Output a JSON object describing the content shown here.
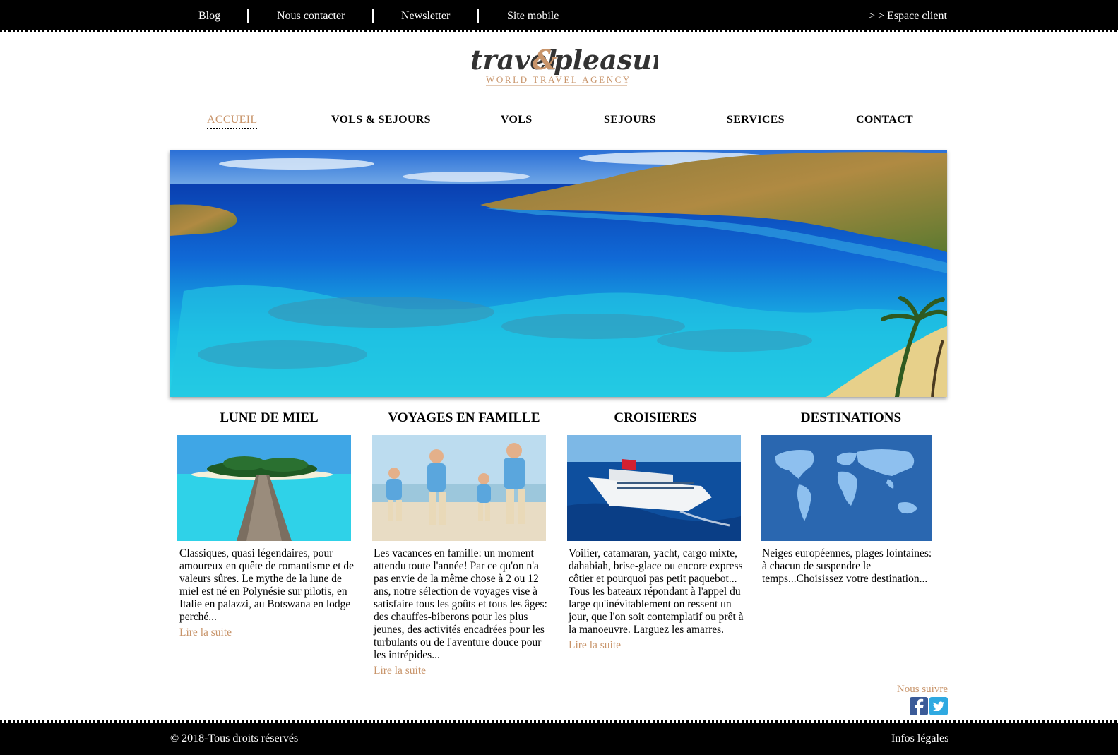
{
  "topbar": {
    "links": [
      "Blog",
      "Nous contacter",
      "Newsletter",
      "Site mobile"
    ],
    "client_link": "> > Espace client"
  },
  "logo": {
    "word1": "travel",
    "ampersand": "&",
    "word2": "pleasure",
    "tagline": "WORLD TRAVEL AGENCY"
  },
  "nav": {
    "items": [
      "ACCUEIL",
      "VOLS & SEJOURS",
      "VOLS",
      "SEJOURS",
      "SERVICES",
      "CONTACT"
    ],
    "active": "ACCUEIL"
  },
  "columns": [
    {
      "title": "LUNE DE MIEL",
      "text": "Classiques, quasi légendaires, pour amoureux en quête de romantisme et de valeurs sûres. Le mythe de la lune de miel est né en Polynésie sur pilotis, en Italie en palazzi, au Botswana en lodge perché...",
      "link": "Lire la suite"
    },
    {
      "title": "VOYAGES EN FAMILLE",
      "text": "Les vacances en famille: un moment attendu toute l'année! Par ce qu'on n'a pas envie de la même chose à 2 ou 12 ans, notre sélection de voyages vise à satisfaire tous les goûts et tous les âges: des chauffes-biberons pour les plus jeunes, des activités encadrées pour les turbulants ou de l'aventure douce pour les intrépides...",
      "link": "Lire la suite"
    },
    {
      "title": "CROISIERES",
      "text": "Voilier, catamaran, yacht, cargo mixte, dahabiah, brise-glace ou encore express côtier et pourquoi pas petit paquebot... Tous les bateaux répondant à l'appel du large qu'inévitablement on ressent un jour, que l'on soit contemplatif ou prêt à la manoeuvre. Larguez les amarres.",
      "link": "Lire la suite"
    },
    {
      "title": "DESTINATIONS",
      "text": "Neiges européennes, plages lointaines: à chacun de suspendre le temps...Choisissez votre destination...",
      "link": ""
    }
  ],
  "follow": {
    "label": "Nous suivre",
    "icons": [
      "facebook-icon",
      "twitter-icon"
    ]
  },
  "footer": {
    "copyright": "© 2018-Tous droits réservés",
    "legal": "Infos légales"
  },
  "colors": {
    "accent": "#c8946a",
    "bar": "#000000",
    "background": "#ffffff"
  }
}
